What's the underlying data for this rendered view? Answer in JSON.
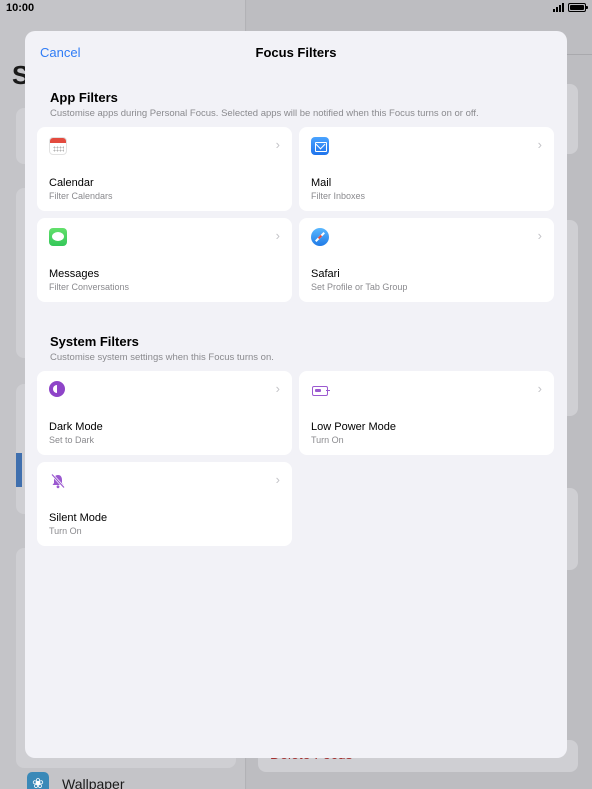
{
  "status_bar": {
    "time": "10:00"
  },
  "background": {
    "left_title_partial": "S",
    "delete_label": "Delete Focus",
    "wallpaper_label": "Wallpaper"
  },
  "sheet": {
    "cancel_label": "Cancel",
    "title": "Focus Filters",
    "app_filters": {
      "title": "App Filters",
      "subtitle": "Customise apps during Personal Focus. Selected apps will be notified when this Focus turns on or off.",
      "items": [
        {
          "name": "Calendar",
          "desc": "Filter Calendars",
          "icon": "calendar-icon"
        },
        {
          "name": "Mail",
          "desc": "Filter Inboxes",
          "icon": "mail-icon"
        },
        {
          "name": "Messages",
          "desc": "Filter Conversations",
          "icon": "messages-icon"
        },
        {
          "name": "Safari",
          "desc": "Set Profile or Tab Group",
          "icon": "safari-icon"
        }
      ]
    },
    "system_filters": {
      "title": "System Filters",
      "subtitle": "Customise system settings when this Focus turns on.",
      "items": [
        {
          "name": "Dark Mode",
          "desc": "Set to Dark",
          "icon": "dark-mode-icon"
        },
        {
          "name": "Low Power Mode",
          "desc": "Turn On",
          "icon": "low-power-icon"
        },
        {
          "name": "Silent Mode",
          "desc": "Turn On",
          "icon": "silent-mode-icon"
        }
      ]
    }
  },
  "colors": {
    "accent": "#2f7cf6",
    "system_icon": "#9b59d0",
    "sheet_bg": "#f2f2f7"
  }
}
